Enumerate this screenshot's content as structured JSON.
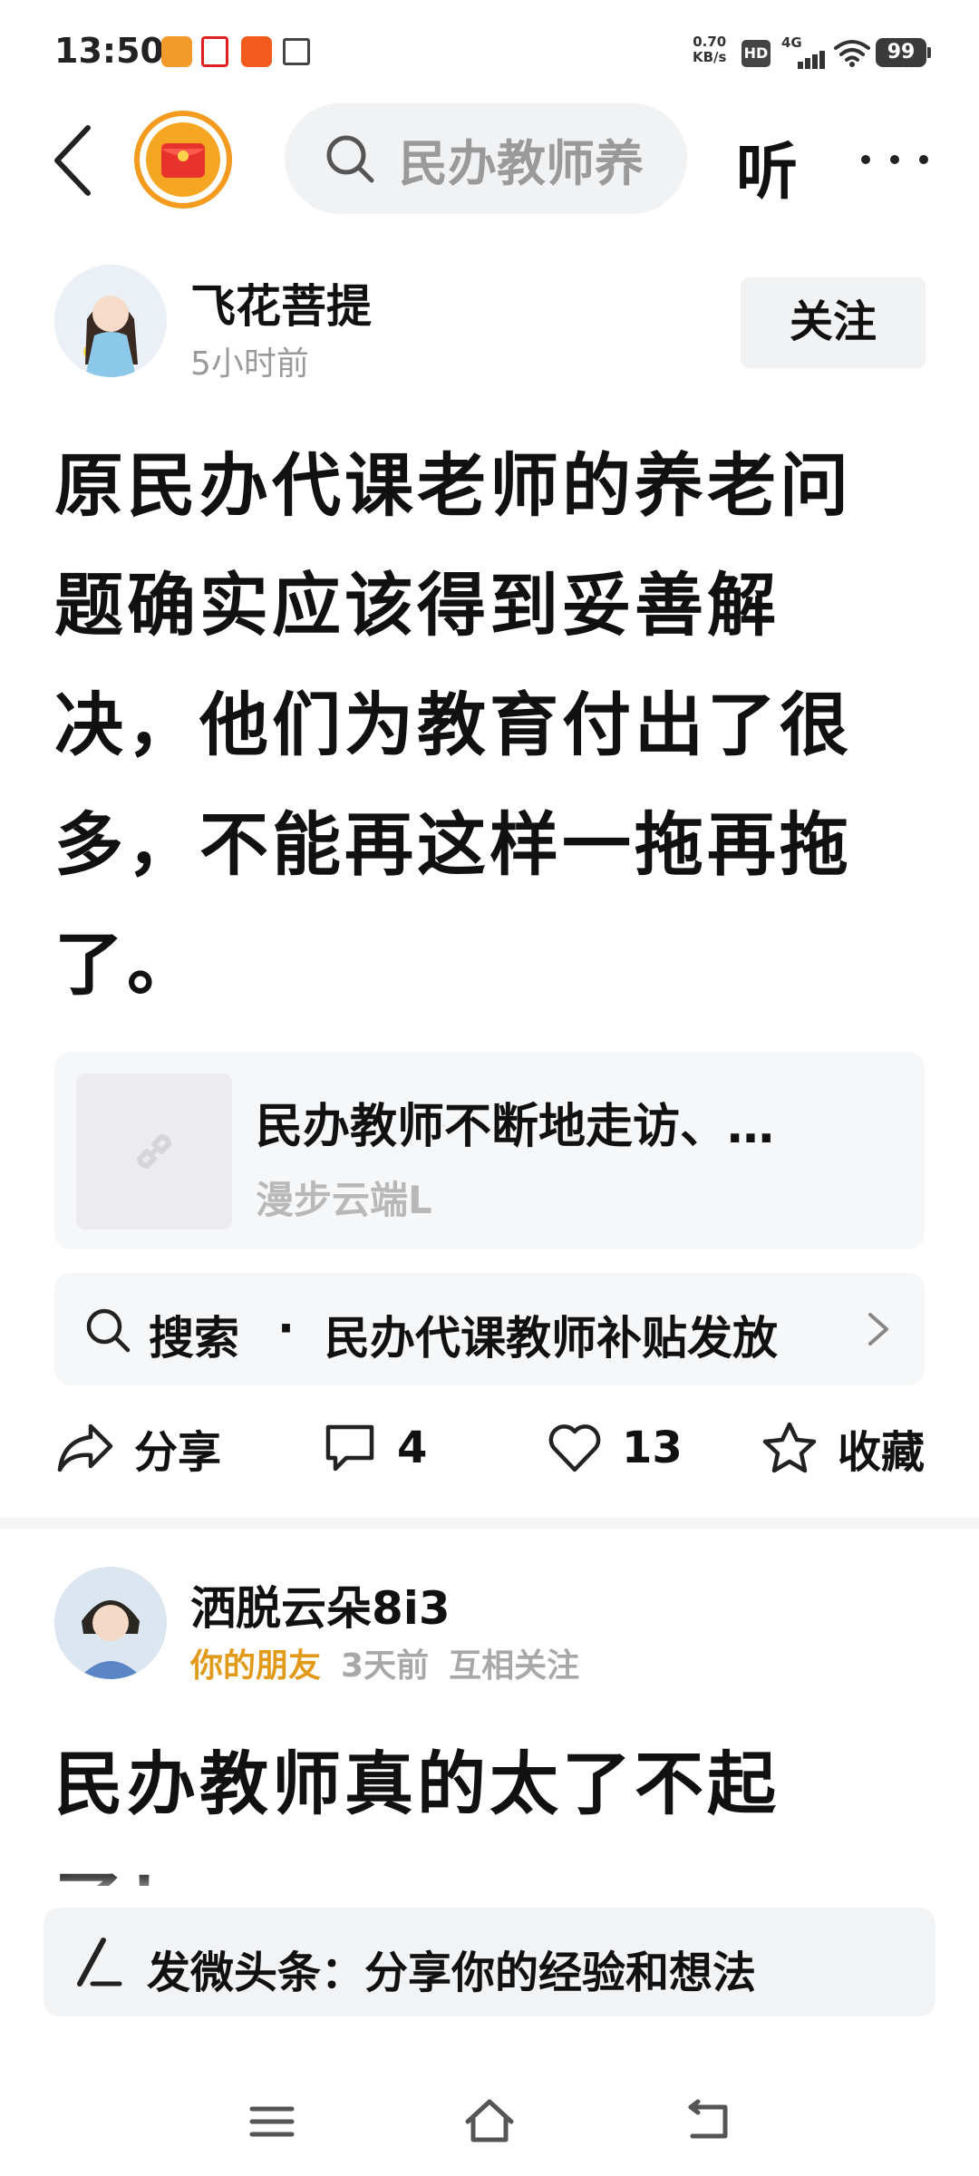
{
  "status_bar": {
    "time": "13:50",
    "net_speed_value": "0.70",
    "net_speed_unit": "KB/s",
    "hd_label": "HD",
    "network_label": "4G",
    "battery": "99"
  },
  "nav": {
    "search_text": "民办教师养",
    "listen_label": "听"
  },
  "post1": {
    "author_name": "飞花菩提",
    "time": "5小时前",
    "follow_label": "关注",
    "text": "原民办代课老师的养老问题确实应该得到妥善解决，他们为教育付出了很多，不能再这样一拖再拖了。",
    "link_card": {
      "title": "民办教师不断地走访、…",
      "source": "漫步云端L"
    },
    "search_suggestion": {
      "label": "搜索",
      "separator": "·",
      "query": "民办代课教师补贴发放"
    },
    "actions": {
      "share_label": "分享",
      "comment_count": "4",
      "like_count": "13",
      "favorite_label": "收藏"
    }
  },
  "post2": {
    "author_name": "洒脱云朵8i3",
    "friend_tag": "你的朋友",
    "time": "3天前",
    "relation": "互相关注",
    "text": "民办教师真的太了不起了！"
  },
  "compose": {
    "label": "发微头条：分享你的经验和想法"
  },
  "colors": {
    "accent_orange": "#f39a1f",
    "friend_tag": "#e29a1a",
    "muted_text": "#9a9a9a",
    "card_bg": "#f6f7f8"
  }
}
